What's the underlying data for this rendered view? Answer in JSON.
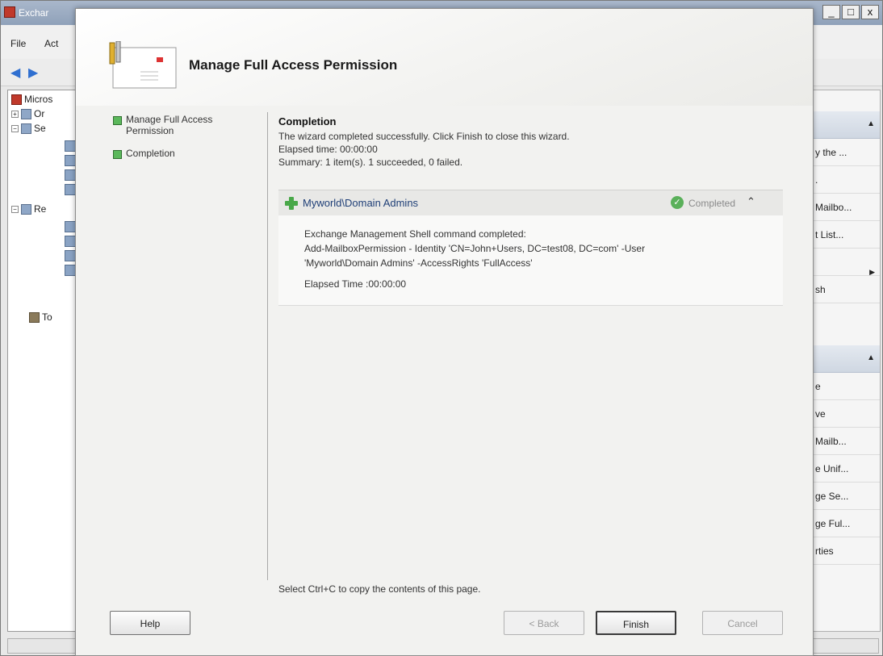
{
  "background_window": {
    "title": "Exchar",
    "window_controls": [
      "_",
      "□",
      "x"
    ],
    "menu": [
      "File",
      "Act"
    ],
    "tree": [
      {
        "label": "Micros",
        "expander": ""
      },
      {
        "label": "Or",
        "expander": "+"
      },
      {
        "label": "Se",
        "expander": "−"
      },
      {
        "label": "Re",
        "expander": "−"
      },
      {
        "label": "To",
        "expander": ""
      }
    ],
    "actions_items": [
      "y the ...",
      ".",
      "Mailbo...",
      "t List...",
      "",
      "sh",
      "e",
      "ve",
      "Mailb...",
      "e Unif...",
      "ge Se...",
      "ge Ful...",
      "rties"
    ]
  },
  "wizard": {
    "title": "Manage Full Access Permission",
    "steps": [
      {
        "label": "Manage Full Access Permission"
      },
      {
        "label": "Completion"
      }
    ],
    "content": {
      "heading": "Completion",
      "message": "The wizard completed successfully. Click Finish to close this wizard.",
      "elapsed": "Elapsed time: 00:00:00",
      "summary": "Summary: 1 item(s). 1 succeeded, 0 failed.",
      "result": {
        "name": "Myworld\\Domain Admins",
        "status": "Completed",
        "status_color": "#5ab05a",
        "lines": [
          "Exchange Management Shell command completed:",
          "Add-MailboxPermission - Identity 'CN=John+Users, DC=test08, DC=com' -User",
          "'Myworld\\Domain Admins' -AccessRights 'FullAccess'"
        ],
        "elapsed": "Elapsed Time :00:00:00"
      },
      "copy_hint": "Select Ctrl+C to copy the contents of this page."
    },
    "buttons": {
      "help": "Help",
      "back": "< Back",
      "finish": "Finish",
      "cancel": "Cancel"
    }
  }
}
